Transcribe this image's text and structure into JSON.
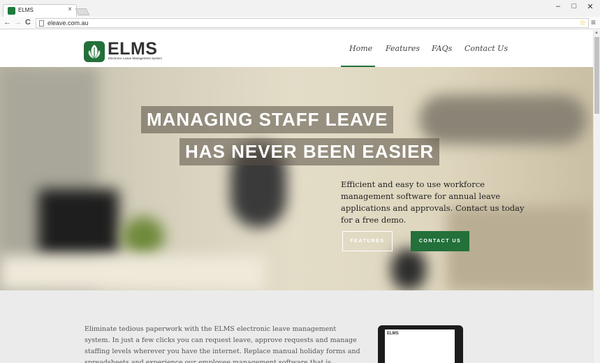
{
  "browser": {
    "tab_title": "ELMS",
    "tab_close": "×",
    "controls": {
      "minimize": "‒",
      "maximize": "□",
      "close": "✕"
    },
    "nav": {
      "back": "←",
      "forward": "→",
      "reload": "C"
    },
    "url": "eleave.com.au",
    "star": "☆",
    "menu": "≡"
  },
  "site": {
    "logo_text": "ELMS",
    "logo_tagline": "Electronic Leave Management System",
    "nav": [
      {
        "label": "Home",
        "active": true
      },
      {
        "label": "Features",
        "active": false
      },
      {
        "label": "FAQs",
        "active": false
      },
      {
        "label": "Contact Us",
        "active": false
      }
    ],
    "accent_color": "#23703a"
  },
  "hero": {
    "headline_1": "MANAGING STAFF LEAVE",
    "headline_2": "HAS NEVER BEEN EASIER",
    "description": "Efficient and easy to use workforce management software for annual leave applications and approvals. Contact us today for a free demo.",
    "btn_features": "FEATURES",
    "btn_contact": "CONTACT US"
  },
  "intro": {
    "text": "Eliminate tedious paperwork with the ELMS electronic leave management system. In just a few clicks you can request leave, approve requests and manage staffing levels wherever you have the internet. Replace manual holiday forms and spreadsheets and experience our employee management software that is accessible anywhere.",
    "tablet_logo": "ELMS"
  }
}
